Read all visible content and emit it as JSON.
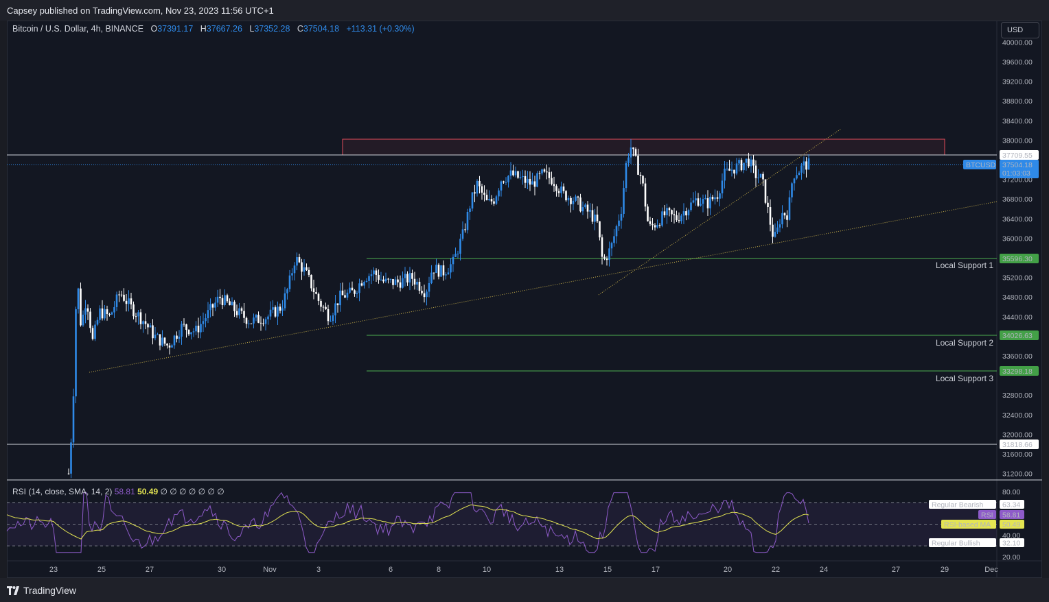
{
  "header": {
    "title": "Capsey published on TradingView.com, Nov 23, 2023 11:56 UTC+1"
  },
  "symbol": {
    "name": "Bitcoin / U.S. Dollar, 4h, BINANCE",
    "o_label": "O",
    "o": "37391.17",
    "h_label": "H",
    "h": "37667.26",
    "l_label": "L",
    "l": "37352.28",
    "c_label": "C",
    "c": "37504.18",
    "change": "+113.31 (+0.30%)"
  },
  "currency_button": "USD",
  "price_axis": [
    "40000.00",
    "39600.00",
    "39200.00",
    "38800.00",
    "38400.00",
    "38000.00",
    "37200.00",
    "36800.00",
    "36400.00",
    "36000.00",
    "35200.00",
    "34800.00",
    "34400.00",
    "33600.00",
    "32800.00",
    "32400.00",
    "32000.00",
    "31600.00",
    "31200.00"
  ],
  "rsi_axis": [
    "80.00",
    "40.00",
    "20.00"
  ],
  "time_axis": [
    "23",
    "25",
    "27",
    "30",
    "Nov",
    "3",
    "6",
    "8",
    "10",
    "13",
    "15",
    "17",
    "20",
    "22",
    "24",
    "27",
    "29",
    "Dec"
  ],
  "levels": {
    "resistance": {
      "price": "37709.55"
    },
    "lower_white": {
      "price": "31818.66"
    },
    "support1": {
      "label": "Local Support 1",
      "price": "35596.30"
    },
    "support2": {
      "label": "Local Support 2",
      "price": "34026.63"
    },
    "support3": {
      "label": "Local Support 3",
      "price": "33298.18"
    }
  },
  "current": {
    "ticker": "BTCUSD",
    "price": "37504.18",
    "countdown": "01:03:03"
  },
  "rsi": {
    "legend": "RSI (14, close, SMA, 14, 2)",
    "value": "58.81",
    "ma": "50.49",
    "extras": "∅ ∅ ∅ ∅ ∅ ∅ ∅",
    "labels": {
      "bearish": {
        "text": "Regular Bearish",
        "value": "63.34"
      },
      "rsi": {
        "text": "RSI",
        "value": "58.81"
      },
      "ma": {
        "text": "RSI-based MA",
        "value": "50.49"
      },
      "bullish": {
        "text": "Regular Bullish",
        "value": "32.10"
      }
    }
  },
  "colors": {
    "up": "#2f8ae8",
    "down": "#ffffff",
    "support": "#4caf50",
    "zone": "#e04b5a",
    "rsi": "#8e5bc9",
    "ma": "#e4e552",
    "trend": "#c9b04a"
  },
  "footer": {
    "brand": "TradingView"
  }
}
